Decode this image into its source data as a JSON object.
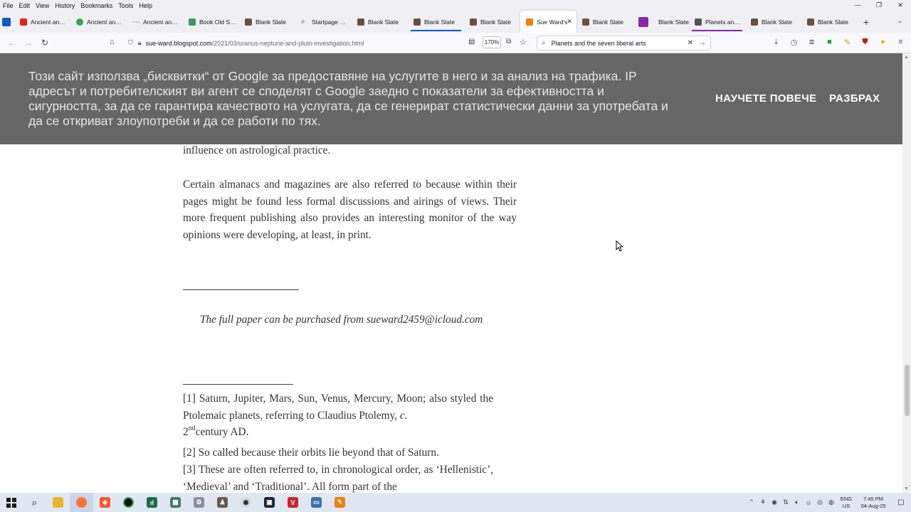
{
  "menu": [
    "File",
    "Edit",
    "View",
    "History",
    "Bookmarks",
    "Tools",
    "Help"
  ],
  "window_controls": [
    "—",
    "❐",
    "✕"
  ],
  "tabs": [
    {
      "label": "Ancient and Ch",
      "color": "#e62117"
    },
    {
      "label": "Ancient and Ch",
      "color": "#2fa84f"
    },
    {
      "label": "Ancient and Ch",
      "color": "#888888"
    },
    {
      "label": "Book Old Stud",
      "color": "#3a9a5b"
    },
    {
      "label": "Blank Slate",
      "color": "#6b4e3d"
    },
    {
      "label": "Startpage Sear",
      "color": "#4a4a4a"
    },
    {
      "label": "Blank Slate",
      "color": "#6b4e3d"
    },
    {
      "label": "Blank Slate",
      "color": "#6b4e3d"
    },
    {
      "label": "Blank Slate",
      "color": "#6b4e3d"
    },
    {
      "label": "Sue Ward's",
      "color": "#f57d00",
      "active": true
    },
    {
      "label": "Blank Slate",
      "color": "#6b4e3d"
    },
    {
      "label": "Blank Slate",
      "color": "#6b4e3d"
    },
    {
      "label": "Planets and th",
      "color": "#555555"
    },
    {
      "label": "Blank Slate",
      "color": "#6b4e3d"
    },
    {
      "label": "Blank Slate",
      "color": "#6b4e3d"
    }
  ],
  "new_tab": "+",
  "url": {
    "host": "sue-ward.blogspot.com",
    "path": "/2021/03/uranus-neptune-and-pluto-investigation.html"
  },
  "zoom": "170%",
  "search": {
    "value": "Planets and the seven liberal arts"
  },
  "cookie": {
    "text": "Този сайт използва „бисквитки“ от Google за предоставяне на услугите в него и за анализ на трафика. IP адресът и потребителският ви агент се споделят с Google заедно с показатели за ефективността и сигурността, за да се гарантира качеството на услугата, да се генерират статистически данни за употребата и да се откриват злоупотреби и да се работи по тях.",
    "learn_more": "НАУЧЕТЕ ПОВЕЧЕ",
    "ok": "РАЗБРАХ"
  },
  "article": {
    "para0": "influence on astrological practice.",
    "para1": "Certain almanacs and magazines are also referred to because within their pages might be found less formal discussions and airings of views. Their more frequent publishing also provides an interesting monitor of the way opinions were developing, at least, in print.",
    "purchase": "The full paper can be purchased from sueward2459@icloud.com",
    "fn1_a": "[1] Saturn, Jupiter, Mars, Sun, Venus, Mercury, Moon; also styled the Ptolemaic planets, referring to Claudius Ptolemy, ",
    "fn1_c": "c.",
    "fn1_2": "2",
    "fn1_sup": "nd",
    "fn1_b": "century AD.",
    "fn2": "[2] So called because their orbits lie beyond that of Saturn.",
    "fn3": "[3] These are often referred to, in chronological order, as ‘Hellenistic’, ‘Medieval’ and ‘Traditional’. All form part of the"
  },
  "tray": {
    "lang_1": "ENG",
    "lang_2": "US",
    "time": "7:45 PM",
    "date": "04-Aug-25"
  }
}
